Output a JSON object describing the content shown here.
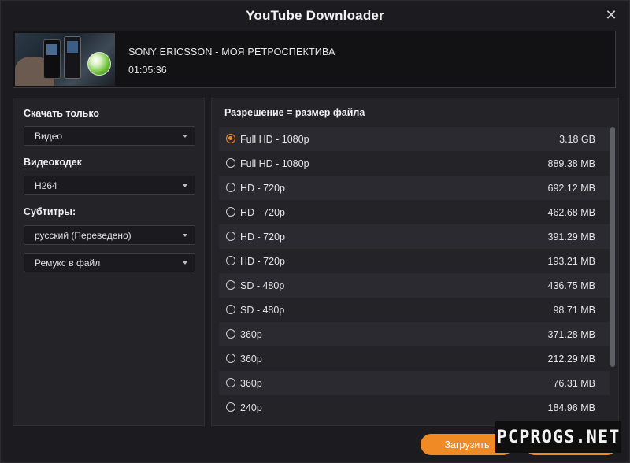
{
  "window": {
    "title": "YouTube Downloader",
    "close_glyph": "✕"
  },
  "video": {
    "title": "SONY ERICSSON - МОЯ РЕТРОСПЕКТИВА",
    "duration": "01:05:36"
  },
  "options": {
    "download_only_label": "Скачать только",
    "download_only_value": "Видео",
    "codec_label": "Видеокодек",
    "codec_value": "H264",
    "subtitles_label": "Субтитры:",
    "subtitles_value": "русский (Переведено)",
    "subtitles_mode_value": "Ремукс в файл"
  },
  "resolutions": {
    "header": "Разрешение = размер файла",
    "items": [
      {
        "name": "Full HD - 1080p",
        "size": "3.18 GB",
        "selected": true
      },
      {
        "name": "Full HD - 1080p",
        "size": "889.38 MB",
        "selected": false
      },
      {
        "name": "HD - 720p",
        "size": "692.12 MB",
        "selected": false
      },
      {
        "name": "HD - 720p",
        "size": "462.68 MB",
        "selected": false
      },
      {
        "name": "HD - 720p",
        "size": "391.29 MB",
        "selected": false
      },
      {
        "name": "HD - 720p",
        "size": "193.21 MB",
        "selected": false
      },
      {
        "name": "SD - 480p",
        "size": "436.75 MB",
        "selected": false
      },
      {
        "name": "SD - 480p",
        "size": "98.71 MB",
        "selected": false
      },
      {
        "name": "360p",
        "size": "371.28 MB",
        "selected": false
      },
      {
        "name": "360p",
        "size": "212.29 MB",
        "selected": false
      },
      {
        "name": "360p",
        "size": "76.31 MB",
        "selected": false
      },
      {
        "name": "240p",
        "size": "184.96 MB",
        "selected": false
      }
    ]
  },
  "footer": {
    "download_label": "Загрузить"
  },
  "watermark": "PCPROGS.NET",
  "colors": {
    "accent": "#f08a24",
    "background": "#1c1c20",
    "panel": "#232328"
  }
}
